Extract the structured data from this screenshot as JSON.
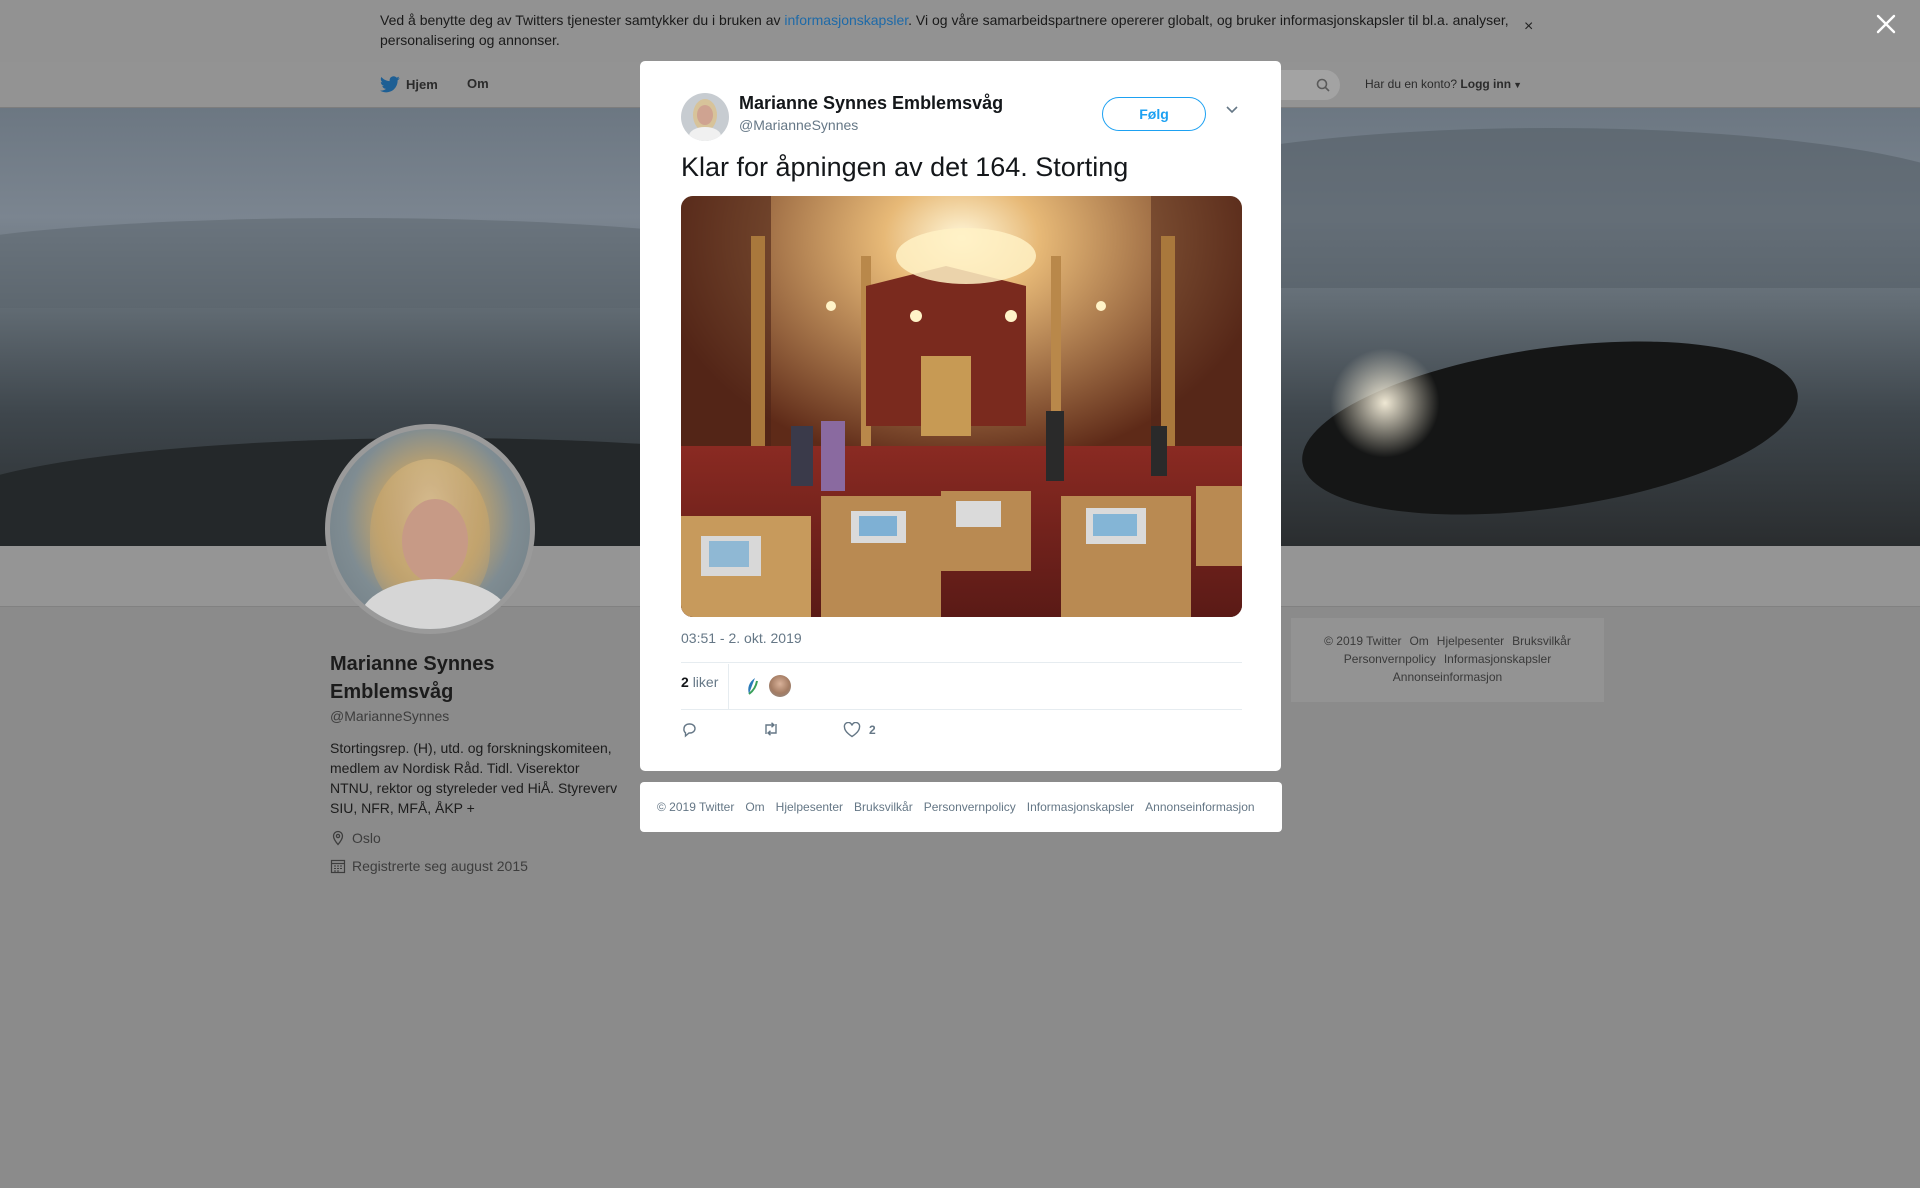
{
  "cookie_banner": {
    "text_before": "Ved å benytte deg av Twitters tjenester samtykker du i bruken av ",
    "link": "informasjonskapsler",
    "text_after": ". Vi og våre samarbeidspartnere opererer globalt, og bruker informasjonskapsler til bl.a. analyser, personalisering og annonser.",
    "close": "×"
  },
  "nav": {
    "home": "Hjem",
    "about": "Om",
    "account_prompt": "Har du en konto?",
    "login": "Logg inn"
  },
  "profile": {
    "name": "Marianne Synnes Emblemsvåg",
    "handle": "@MarianneSynnes",
    "bio": "Stortingsrep. (H), utd. og forskningskomiteen, medlem av Nordisk Råd. Tidl. Viserektor NTNU, rektor og styreleder ved HiÅ. Styreverv SIU, NFR, MFÅ, ÅKP +",
    "location": "Oslo",
    "joined": "Registrerte seg august 2015"
  },
  "side_footer": {
    "items": [
      "© 2019 Twitter",
      "Om",
      "Hjelpesenter",
      "Bruksvilkår",
      "Personvernpolicy",
      "Informasjonskapsler",
      "Annonseinformasjon"
    ]
  },
  "tweet": {
    "author_name": "Marianne Synnes Emblemsvåg",
    "author_handle": "@MarianneSynnes",
    "follow_label": "Følg",
    "text": "Klar for åpningen av det 164. Storting",
    "timestamp": "03:51 - 2. okt. 2019",
    "likes_count": "2",
    "likes_label": "liker",
    "like_action_count": "2"
  },
  "modal_footer": {
    "items": [
      "© 2019 Twitter",
      "Om",
      "Hjelpesenter",
      "Bruksvilkår",
      "Personvernpolicy",
      "Informasjonskapsler",
      "Annonseinformasjon"
    ]
  },
  "colors": {
    "accent": "#1da1f2",
    "overlay": "#8b8b8b",
    "muted_text": "#657786"
  }
}
